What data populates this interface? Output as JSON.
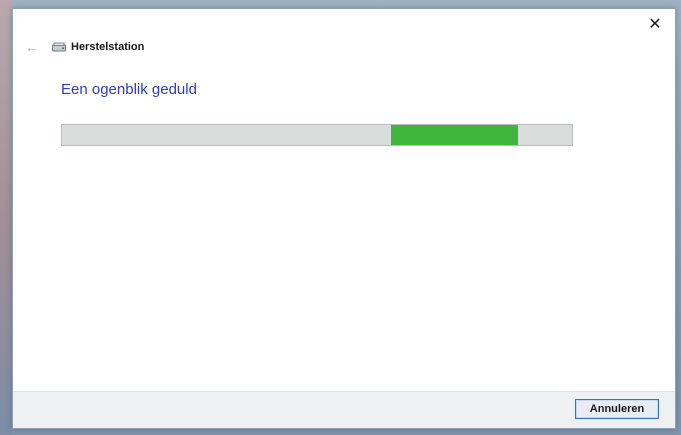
{
  "window": {
    "title": "Herstelstation",
    "close_symbol": "✕"
  },
  "header": {
    "back_symbol": "←",
    "back_icon": "back-arrow-icon",
    "drive_icon": "drive-icon"
  },
  "main": {
    "heading": "Een ogenblik geduld",
    "progress": {
      "type": "marquee",
      "segment_start_fraction": 0.645,
      "segment_end_fraction": 0.895,
      "color": "#3fb73c"
    }
  },
  "footer": {
    "cancel_label": "Annuleren"
  },
  "colors": {
    "accent": "#2f3db1",
    "progress_track": "#dadcdc",
    "button_border": "#3a6fc8"
  }
}
